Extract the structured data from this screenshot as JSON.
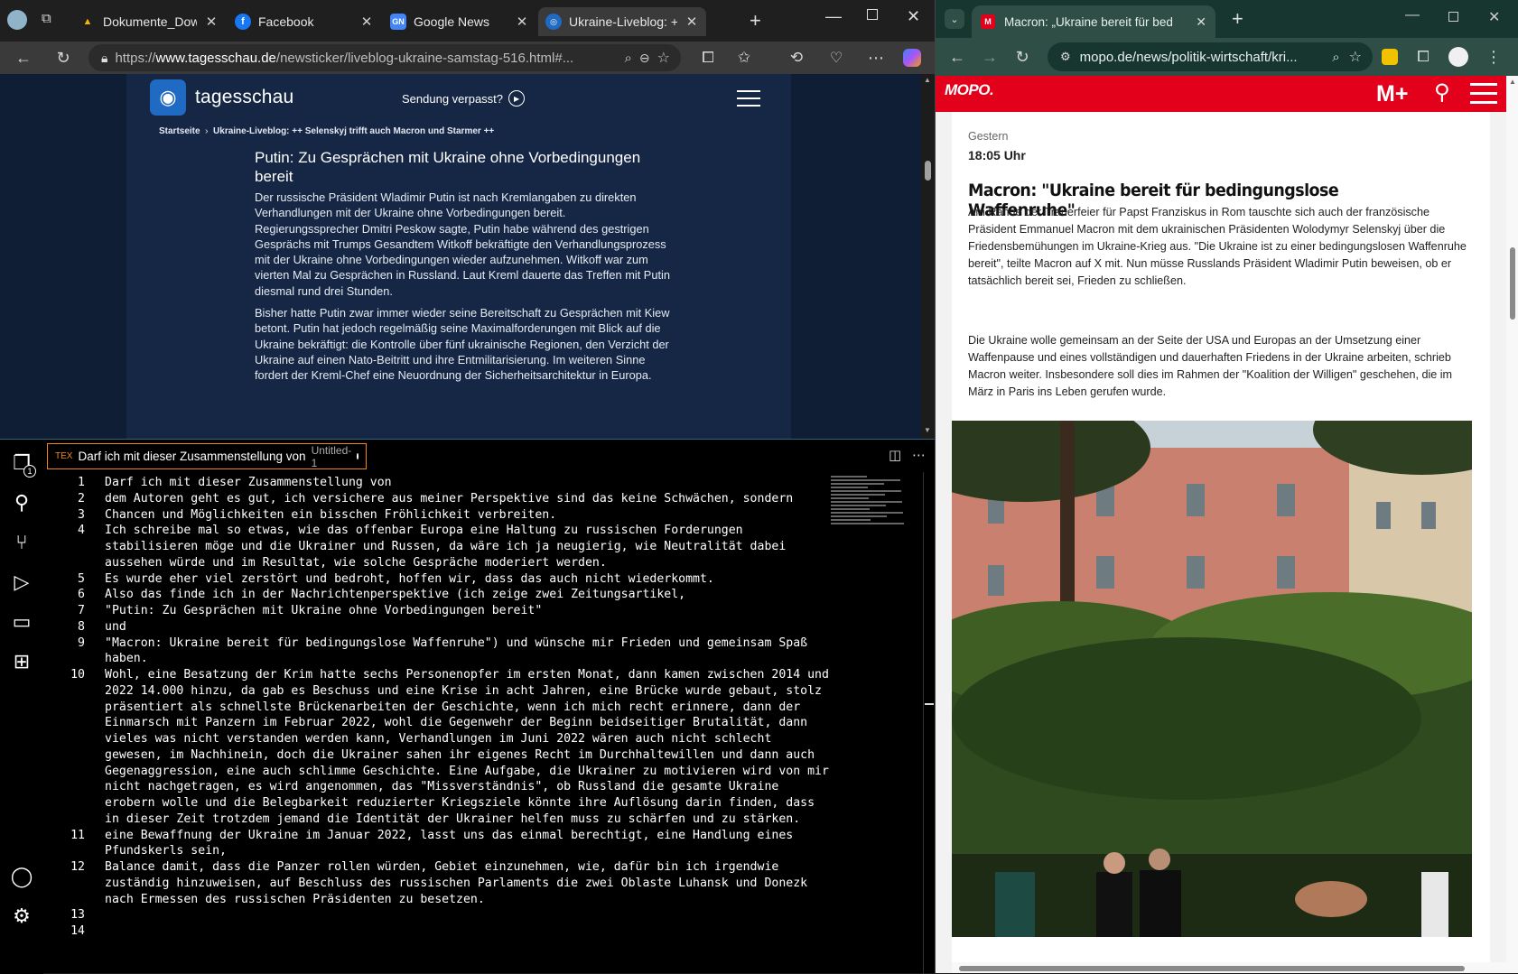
{
  "edge": {
    "tabs": [
      {
        "title": "Dokumente_Download",
        "icon": "drive-icon"
      },
      {
        "title": "Facebook",
        "icon": "facebook-icon"
      },
      {
        "title": "Google News",
        "icon": "google-news-icon"
      },
      {
        "title": "Ukraine-Liveblog: ++ S",
        "icon": "tagesschau-icon"
      }
    ],
    "url_prefix": "https://",
    "url_host": "www.tagesschau.de",
    "url_path": "/newsticker/liveblog-ukraine-samstag-516.html#...",
    "page": {
      "brand": "tagesschau",
      "sendung": "Sendung verpasst?",
      "crumb_home": "Startseite",
      "crumb_sep": "›",
      "crumb_current": "Ukraine-Liveblog: ++ Selenskyj trifft auch Macron und Starmer ++",
      "headline": "Putin: Zu Gesprächen mit Ukraine ohne Vorbedingungen bereit",
      "para1": "Der russische Präsident Wladimir Putin ist nach Kremlangaben zu direkten Verhandlungen mit der Ukraine ohne Vorbedingungen bereit. Regierungssprecher Dmitri Peskow sagte, Putin habe während des gestrigen Gesprächs mit Trumps Gesandtem Witkoff bekräftigte den Verhandlungsprozess mit der Ukraine ohne Vorbedingungen wieder aufzunehmen. Witkoff war zum vierten Mal zu Gesprächen in Russland. Laut Kreml dauerte das Treffen mit Putin diesmal rund drei Stunden.",
      "para2": "Bisher hatte Putin zwar immer wieder seine Bereitschaft zu Gesprächen mit Kiew betont. Putin hat jedoch regelmäßig seine Maximalforderungen mit Blick auf die Ukraine bekräftigt: die Kontrolle über fünf ukrainische Regionen, den Verzicht der Ukraine auf einen Nato-Beitritt und ihre Entmilitarisierung. Im weiteren Sinne fordert der Kreml-Chef eine Neuordnung der Sicherheitsarchitektur in Europa."
    }
  },
  "vscode": {
    "tab_title": "Darf ich mit dieser Zusammenstellung von",
    "tab_file": "Untitled-1",
    "lines": [
      {
        "n": "1",
        "t": "Darf ich mit dieser Zusammenstellung von"
      },
      {
        "n": "2",
        "t": "dem Autoren geht es gut, ich versichere aus meiner Perspektive sind das keine Schwächen, sondern"
      },
      {
        "n": "3",
        "t": "Chancen und Möglichkeiten ein bisschen Fröhlichkeit verbreiten."
      },
      {
        "n": "4",
        "t": "Ich schreibe mal so etwas, wie das offenbar Europa eine Haltung zu russischen Forderungen"
      },
      {
        "n": "",
        "t": "stabilisieren möge und die Ukrainer und Russen, da wäre ich ja neugierig, wie Neutralität dabei"
      },
      {
        "n": "",
        "t": "aussehen würde und im Resultat, wie solche Gespräche moderiert werden."
      },
      {
        "n": "5",
        "t": "Es wurde eher viel zerstört und bedroht, hoffen wir, dass das auch nicht wiederkommt."
      },
      {
        "n": "6",
        "t": "Also das finde ich in der Nachrichtenperspektive (ich zeige zwei Zeitungsartikel,"
      },
      {
        "n": "7",
        "t": "\"Putin: Zu Gesprächen mit Ukraine ohne Vorbedingungen bereit\""
      },
      {
        "n": "8",
        "t": "und"
      },
      {
        "n": "9",
        "t": "\"Macron: Ukraine bereit für bedingungslose Waffenruhe\") und wünsche mir Frieden und gemeinsam Spaß"
      },
      {
        "n": "",
        "t": "haben."
      },
      {
        "n": "10",
        "t": "Wohl, eine Besatzung der Krim hatte sechs Personenopfer im ersten Monat, dann kamen zwischen 2014 und"
      },
      {
        "n": "",
        "t": "2022 14.000 hinzu, da gab es Beschuss und eine Krise in acht Jahren, eine Brücke wurde gebaut, stolz"
      },
      {
        "n": "",
        "t": "präsentiert als schnellste Brückenarbeiten der Geschichte, wenn ich mich recht erinnere, dann der"
      },
      {
        "n": "",
        "t": "Einmarsch mit Panzern im Februar 2022, wohl die Gegenwehr der Beginn beidseitiger Brutalität, dann"
      },
      {
        "n": "",
        "t": "vieles was nicht verstanden werden kann, Verhandlungen im Juni 2022 wären auch nicht schlecht"
      },
      {
        "n": "",
        "t": "gewesen, im Nachhinein, doch die Ukrainer sahen ihr eigenes Recht im Durchhaltewillen und dann auch"
      },
      {
        "n": "",
        "t": "Gegenaggression, eine auch schlimme Geschichte. Eine Aufgabe, die Ukrainer zu motivieren wird von mir"
      },
      {
        "n": "",
        "t": "nicht nachgetragen, es wird angenommen, das \"Missverständnis\", ob Russland die gesamte Ukraine"
      },
      {
        "n": "",
        "t": "erobern wolle und die Belegbarkeit reduzierter Kriegsziele könnte ihre Auflösung darin finden, dass"
      },
      {
        "n": "",
        "t": "in dieser Zeit trotzdem jemand die Identität der Ukrainer helfen muss zu schärfen und zu stärken."
      },
      {
        "n": "11",
        "t": "eine Bewaffnung der Ukraine im Januar 2022, lasst uns das einmal berechtigt, eine Handlung eines"
      },
      {
        "n": "",
        "t": "Pfundskerls sein,"
      },
      {
        "n": "12",
        "t": "Balance damit, dass die Panzer rollen würden, Gebiet einzunehmen, wie, dafür bin ich irgendwie"
      },
      {
        "n": "",
        "t": "zuständig hinzuweisen, auf Beschluss des russischen Parlaments die zwei Oblaste Luhansk und Donezk"
      },
      {
        "n": "",
        "t": "nach Ermessen des russischen Präsidenten zu besetzen."
      },
      {
        "n": "13",
        "t": ""
      },
      {
        "n": "14",
        "t": ""
      }
    ],
    "badge": "1"
  },
  "chrome": {
    "tab_title": "Macron: „Ukraine bereit für bed",
    "url": "mopo.de/news/politik-wirtschaft/kri...",
    "page": {
      "logo": "MOPO.",
      "plus": "M+",
      "day": "Gestern",
      "time": "18:05 Uhr",
      "title": "Macron: \"Ukraine bereit für bedingungslose Waffenruhe\"",
      "para1": "Am Rande der Trauerfeier für Papst Franziskus in Rom tauschte sich auch der französische Präsident Emmanuel Macron mit dem ukrainischen Präsidenten Wolodymyr Selenskyj über die Friedensbemühungen im Ukraine-Krieg aus. \"Die Ukraine ist zu einer bedingungslosen Waffenruhe bereit\", teilte Macron auf X mit. Nun müsse Russlands Präsident Wladimir Putin beweisen, ob er tatsächlich bereit sei, Frieden zu schließen.",
      "para2": "Die Ukraine wolle gemeinsam an der Seite der USA und Europas an der Umsetzung einer Waffenpause und eines vollständigen und dauerhaften Friedens in der Ukraine arbeiten, schrieb Macron weiter. Insbesondere soll dies im Rahmen der \"Koalition der Willigen\" geschehen, die im März in Paris ins Leben gerufen wurde."
    }
  },
  "colors": {
    "tagesschau_bg": "#152744",
    "mopo_red": "#e2001a",
    "chrome_frame": "#2f4e46",
    "vscode_accent": "#f38518"
  }
}
